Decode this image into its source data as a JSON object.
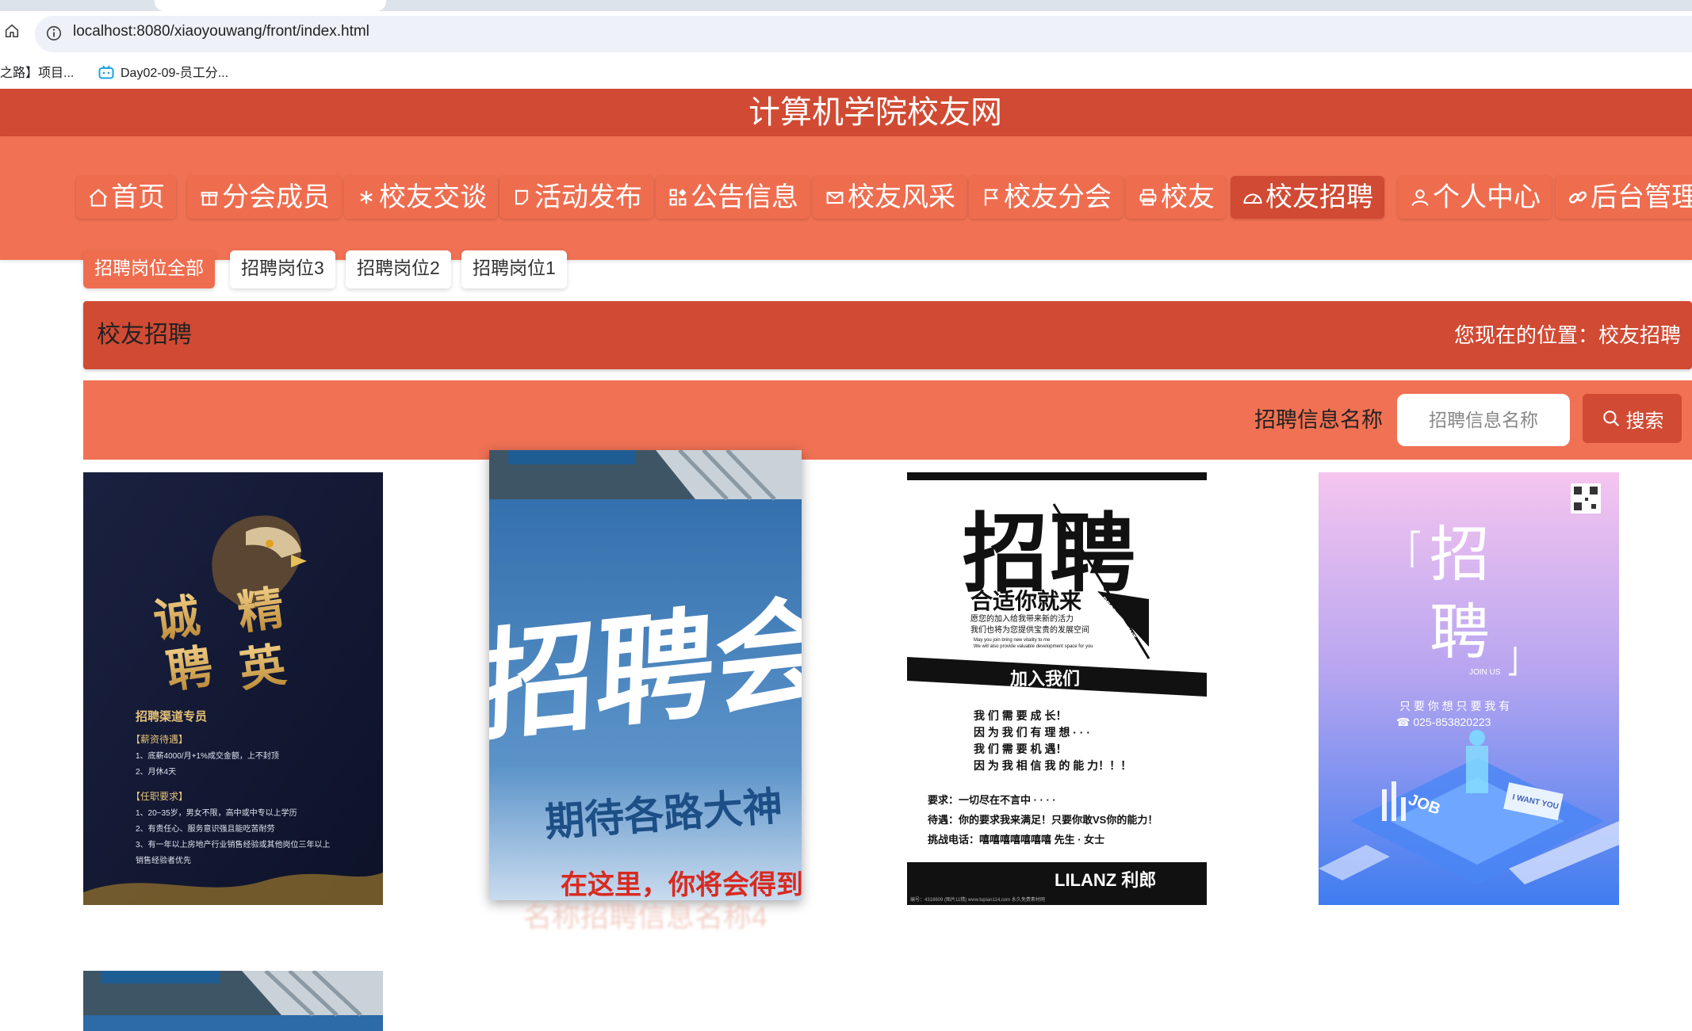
{
  "browser": {
    "url": "localhost:8080/xiaoyouwang/front/index.html",
    "bookmarks": [
      "之路】项目...",
      "Day02-09-员工分..."
    ]
  },
  "site": {
    "title": "计算机学院校友网"
  },
  "nav": {
    "items": [
      {
        "label": "首页",
        "icon": "home-icon"
      },
      {
        "label": "分会成员",
        "icon": "gift-icon"
      },
      {
        "label": "校友交谈",
        "icon": "snowflake-icon"
      },
      {
        "label": "活动发布",
        "icon": "note-icon"
      },
      {
        "label": "公告信息",
        "icon": "grid-icon"
      },
      {
        "label": "校友风采",
        "icon": "mail-icon"
      },
      {
        "label": "校友分会",
        "icon": "flag-icon"
      },
      {
        "label": "校友",
        "icon": "printer-icon"
      },
      {
        "label": "校友招聘",
        "icon": "gauge-icon",
        "active": true
      },
      {
        "label": "个人中心",
        "icon": "user-icon"
      },
      {
        "label": "后台管理",
        "icon": "link-icon"
      }
    ],
    "active_color": "#d14a33"
  },
  "categories": [
    "招聘岗位全部",
    "招聘岗位3",
    "招聘岗位2",
    "招聘岗位1"
  ],
  "location": {
    "title": "校友招聘",
    "crumb": "您现在的位置：校友招聘"
  },
  "search": {
    "label": "招聘信息名称",
    "placeholder": "招聘信息名称",
    "button": "搜索"
  },
  "posters": {
    "p1": {
      "big": [
        "诚",
        "精",
        "聘",
        "英"
      ],
      "heading": "招聘渠道专员",
      "s1": "【薪资待遇】",
      "l1": "1、底薪4000/月+1%成交金额，上不封顶",
      "l2": "2、月休4天",
      "s2": "【任职要求】",
      "l3": "1、20~35岁，男女不限，高中或中专以上学历",
      "l4": "2、有责任心、服务意识强且能吃苦耐劳",
      "l5": "3、有一年以上房地产行业销售经验或其他岗位三年以上",
      "l6": "销售经验者优先"
    },
    "p2": {
      "big": "招聘会",
      "sub": "期待各路大神",
      "bottom": "在这里，你将会得到"
    },
    "p3": {
      "big1": "招",
      "big2": "聘",
      "slogan": "合适你就来",
      "vertical": "RECRUITMENT",
      "sl1": "愿您的加入给我带来新的活力",
      "sl2": "我们也将为您提供宝贵的发展空间",
      "sl3": "May you join bring new vitality to me",
      "sl4": "We will also provide valuable development space for you",
      "join": "加入我们",
      "t1": "我 们 需 要 成 长！",
      "t2": "因 为 我 们 有 理 想 · · ·",
      "t3": "我 们 需 要 机 遇！",
      "t4": "因 为 我 相 信 我 的 能 力！！！",
      "r1": "要求：一切尽在不言中 · · · ·",
      "r2": "待遇：你的要求我来满足！只要你敢VS你的能力！",
      "r3": "挑战电话：嘻嘻嘻嘻嘻嘻嘻   先生 · 女士",
      "brand": "LILANZ 利郎",
      "foot": "编号：4318609 (图片11精) www.tupian114.com 永久免费素材网"
    },
    "p4": {
      "big1": "招",
      "big2": "聘",
      "join": "JOIN  US",
      "l1": "只 要 你 想    只 要 我 有",
      "phone": "☎  025-853820223",
      "want": "I WANT YOU",
      "job": "JOB"
    },
    "caption": "名称招聘信息名称4"
  }
}
